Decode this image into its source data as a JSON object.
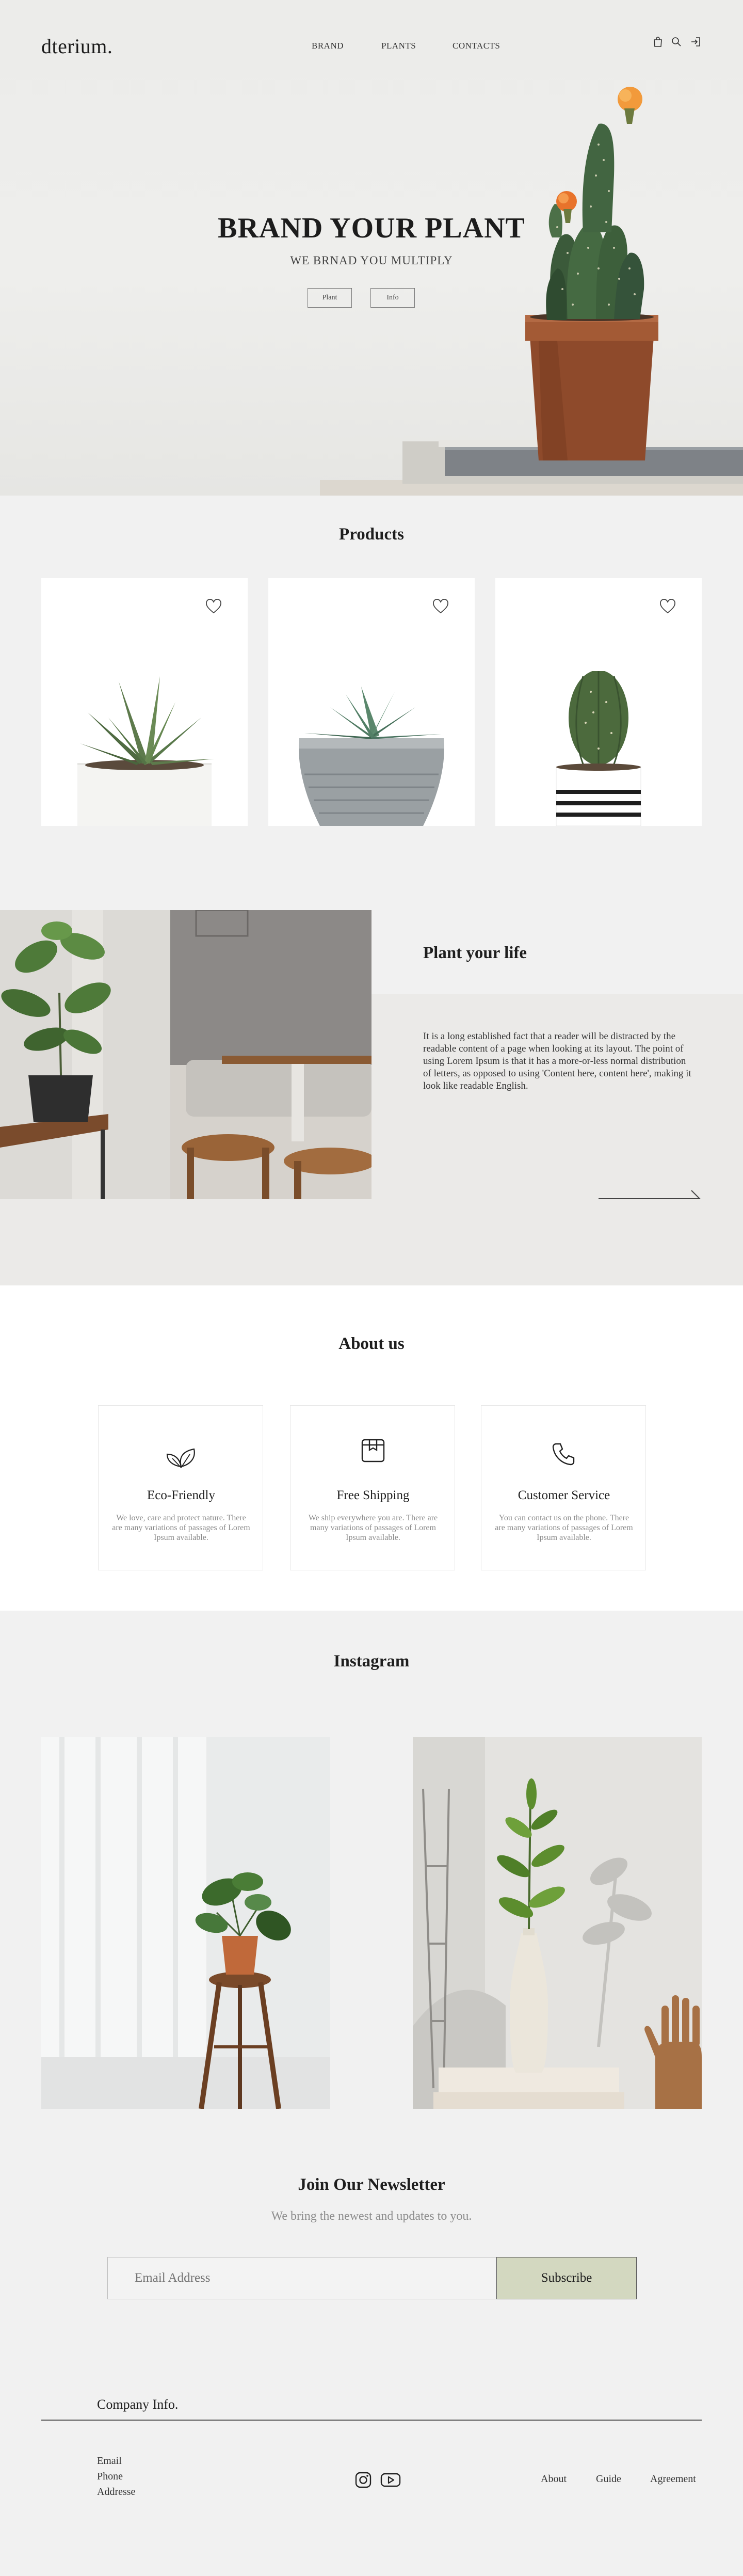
{
  "brand": {
    "logo": "dterium."
  },
  "nav": {
    "items": [
      "BRAND",
      "PLANTS",
      "CONTACTS"
    ],
    "icons": [
      "bag-icon",
      "search-icon",
      "login-icon"
    ]
  },
  "hero": {
    "title": "BRAND YOUR PLANT",
    "subtitle": "WE BRNAD YOU MULTIPLY",
    "buttons": [
      "Plant",
      "Info"
    ]
  },
  "products": {
    "title": "Products",
    "items": [
      {
        "image": "aloe-plant-white-pot"
      },
      {
        "image": "succulent-grey-pot"
      },
      {
        "image": "cactus-striped-pot"
      }
    ]
  },
  "plant_life": {
    "title": "Plant your life",
    "body": "It is a long established fact that a reader will be distracted by the readable content of a page when looking at its layout. The point of using Lorem Ipsum is that it has a more-or-less normal distribution of letters, as opposed to using 'Content here, content here', making it look like readable English."
  },
  "about": {
    "title": "About us",
    "cards": [
      {
        "icon": "leaf-icon",
        "title": "Eco-Friendly",
        "desc": "We love, care and protect nature. There are many variations of passages of Lorem Ipsum available."
      },
      {
        "icon": "package-icon",
        "title": "Free Shipping",
        "desc": "We ship everywhere you are. There are many variations of passages of Lorem Ipsum available."
      },
      {
        "icon": "phone-icon",
        "title": "Customer Service",
        "desc": "You can contact us on the phone. There are many variations of passages of Lorem Ipsum available."
      }
    ]
  },
  "instagram": {
    "title": "Instagram"
  },
  "newsletter": {
    "title": "Join Our Newsletter",
    "subtitle": "We bring the newest and updates to you.",
    "placeholder": "Email Address",
    "button": "Subscribe"
  },
  "footer": {
    "title": "Company Info.",
    "contact": [
      "Email",
      "Phone",
      "Addresse"
    ],
    "social": [
      "instagram-icon",
      "youtube-icon"
    ],
    "links": [
      "About",
      "Guide",
      "Agreement"
    ]
  },
  "colors": {
    "accent": "#d3d8c0",
    "background": "#f1f1f1",
    "card": "#ffffff",
    "terracotta": "#9e4f2c",
    "cactus": "#3d5a3a"
  }
}
